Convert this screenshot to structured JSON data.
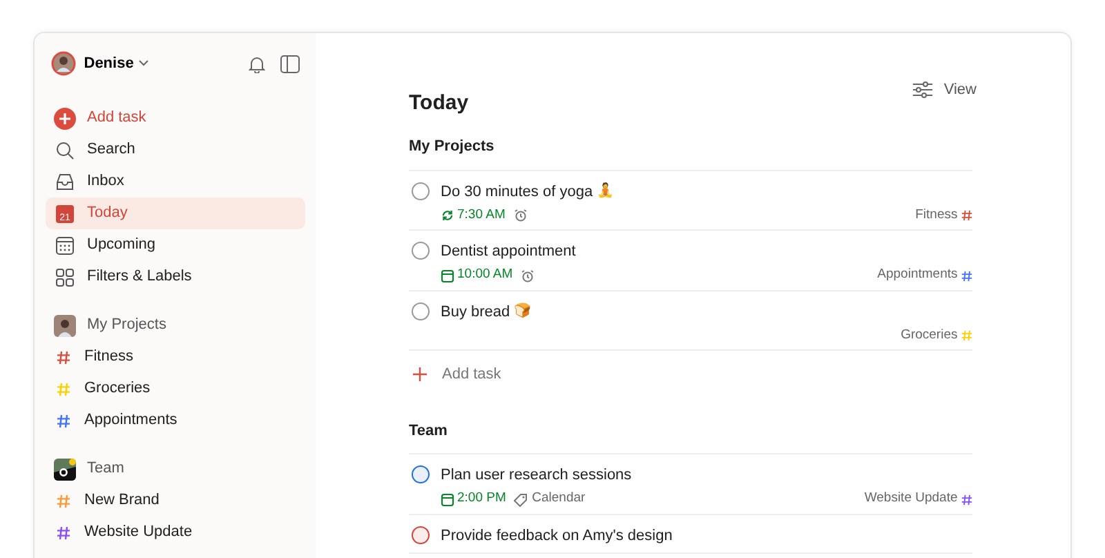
{
  "user": {
    "name": "Denise"
  },
  "nav": [
    {
      "kind": "add",
      "label": "Add task",
      "selected": false
    },
    {
      "kind": "search",
      "label": "Search",
      "selected": false
    },
    {
      "kind": "inbox",
      "label": "Inbox",
      "selected": false
    },
    {
      "kind": "today",
      "label": "Today",
      "selected": true,
      "icon_text": "21"
    },
    {
      "kind": "upcoming",
      "label": "Upcoming",
      "selected": false
    },
    {
      "kind": "filters",
      "label": "Filters & Labels",
      "selected": false
    }
  ],
  "workspaces": [
    {
      "kind": "personal",
      "name": "My Projects",
      "projects": [
        {
          "name": "Fitness",
          "color": "#dc4c3e"
        },
        {
          "name": "Groceries",
          "color": "#fad000"
        },
        {
          "name": "Appointments",
          "color": "#4073ff"
        }
      ]
    },
    {
      "kind": "team",
      "name": "Team",
      "projects": [
        {
          "name": "New Brand",
          "color": "#ff9933"
        },
        {
          "name": "Website Update",
          "color": "#884dff"
        }
      ]
    }
  ],
  "view_button": "View",
  "title": "Today",
  "sections": [
    {
      "name": "My Projects",
      "add_task": "Add task",
      "tasks": [
        {
          "title": "Do 30 minutes of yoga",
          "emoji": "🧘",
          "color": "#999999",
          "recurring": true,
          "date": "7:30 AM",
          "reminder": true,
          "project": {
            "name": "Fitness",
            "color": "#dc4c3e"
          }
        },
        {
          "title": "Dentist appointment",
          "color": "#999999",
          "recurring": false,
          "date": "10:00 AM",
          "reminder": true,
          "project": {
            "name": "Appointments",
            "color": "#4073ff"
          }
        },
        {
          "title": "Buy bread",
          "emoji": "🍞",
          "color": "#999999",
          "project": {
            "name": "Groceries",
            "color": "#fad000"
          }
        }
      ]
    },
    {
      "name": "Team",
      "tasks": [
        {
          "title": "Plan user research sessions",
          "color": "#246fe0",
          "recurring": false,
          "date": "2:00 PM",
          "reminder": false,
          "label": "Calendar",
          "project": {
            "name": "Website Update",
            "color": "#884dff"
          }
        },
        {
          "title": "Provide feedback on Amy's design",
          "color": "#d1453b"
        }
      ]
    }
  ]
}
